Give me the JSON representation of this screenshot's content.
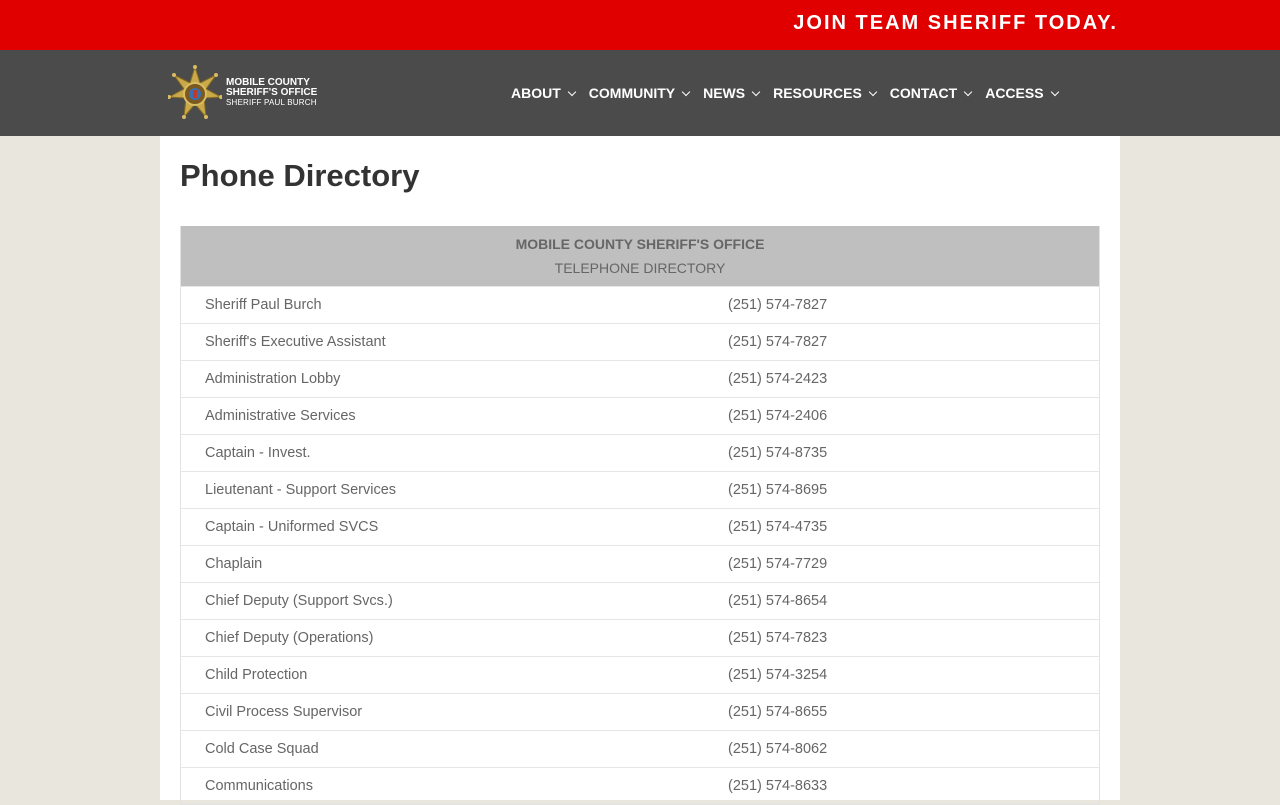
{
  "topbar": {
    "cta": "JOIN TEAM SHERIFF TODAY."
  },
  "logo": {
    "line1": "MOBILE COUNTY",
    "line2": "SHERIFF'S OFFICE",
    "line3": "SHERIFF PAUL BURCH"
  },
  "nav": {
    "items": [
      "ABOUT",
      "COMMUNITY",
      "NEWS",
      "RESOURCES",
      "CONTACT",
      "ACCESS"
    ]
  },
  "page": {
    "title": "Phone Directory"
  },
  "directory": {
    "heading1": "MOBILE COUNTY SHERIFF'S OFFICE",
    "heading2": "TELEPHONE DIRECTORY",
    "rows": [
      {
        "name": "Sheriff Paul Burch",
        "phone": "(251) 574-7827"
      },
      {
        "name": "Sheriff's Executive Assistant",
        "phone": "(251) 574-7827"
      },
      {
        "name": "Administration Lobby",
        "phone": "(251) 574-2423"
      },
      {
        "name": "Administrative Services",
        "phone": "(251) 574-2406"
      },
      {
        "name": "Captain - Invest.",
        "phone": "(251) 574-8735"
      },
      {
        "name": "Lieutenant - Support Services",
        "phone": "(251) 574-8695"
      },
      {
        "name": "Captain - Uniformed SVCS",
        "phone": "(251) 574-4735"
      },
      {
        "name": "Chaplain",
        "phone": "(251) 574-7729"
      },
      {
        "name": "Chief Deputy (Support Svcs.)",
        "phone": "(251) 574-8654"
      },
      {
        "name": "Chief Deputy (Operations)",
        "phone": "(251) 574-7823"
      },
      {
        "name": "Child Protection",
        "phone": "(251) 574-3254"
      },
      {
        "name": "Civil Process Supervisor",
        "phone": "(251) 574-8655"
      },
      {
        "name": "Cold Case Squad",
        "phone": "(251) 574-8062"
      },
      {
        "name": "Communications",
        "phone": "(251) 574-8633"
      }
    ]
  },
  "colors": {
    "topbar": "#e00000",
    "nav": "#4b4b4b",
    "table_header": "#bfbfbf",
    "page_bg": "#e9e6de"
  }
}
